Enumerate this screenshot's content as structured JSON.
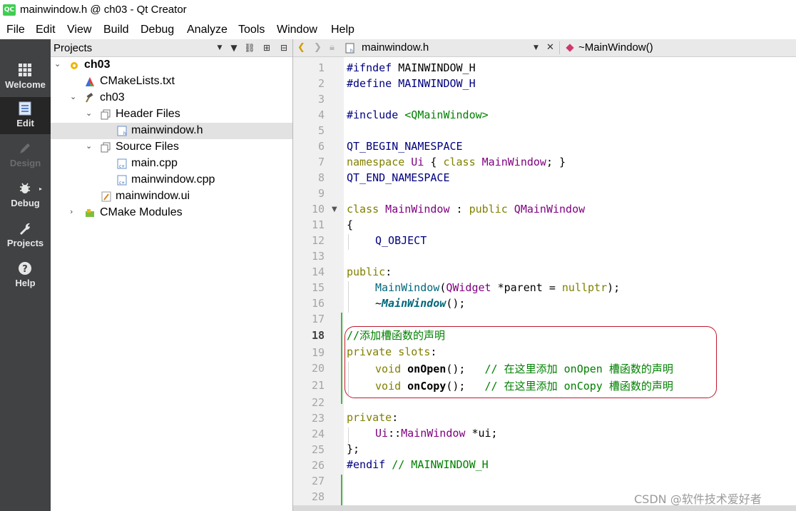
{
  "window": {
    "title": "mainwindow.h @ ch03 - Qt Creator",
    "app_icon": "QC"
  },
  "menu": [
    "File",
    "Edit",
    "View",
    "Build",
    "Debug",
    "Analyze",
    "Tools",
    "Window",
    "Help"
  ],
  "modes": [
    {
      "label": "Welcome",
      "icon": "grid-icon"
    },
    {
      "label": "Edit",
      "icon": "document-icon"
    },
    {
      "label": "Design",
      "icon": "pencil-icon"
    },
    {
      "label": "Debug",
      "icon": "bug-icon"
    },
    {
      "label": "Projects",
      "icon": "wrench-icon"
    },
    {
      "label": "Help",
      "icon": "help-icon"
    }
  ],
  "projects_panel": {
    "title": "Projects",
    "tree": [
      {
        "label": "ch03"
      },
      {
        "label": "CMakeLists.txt"
      },
      {
        "label": "ch03"
      },
      {
        "label": "Header Files"
      },
      {
        "label": "mainwindow.h"
      },
      {
        "label": "Source Files"
      },
      {
        "label": "main.cpp"
      },
      {
        "label": "mainwindow.cpp"
      },
      {
        "label": "mainwindow.ui"
      },
      {
        "label": "CMake Modules"
      }
    ]
  },
  "editor": {
    "file_name": "mainwindow.h",
    "symbol": "~MainWindow()",
    "current_line": 18,
    "lines": [
      "1",
      "2",
      "3",
      "4",
      "5",
      "6",
      "7",
      "8",
      "9",
      "10",
      "11",
      "12",
      "13",
      "14",
      "15",
      "16",
      "17",
      "18",
      "19",
      "20",
      "21",
      "22",
      "23",
      "24",
      "25",
      "26",
      "27",
      "28"
    ],
    "code": {
      "l1a": "#ifndef",
      "l1b": " MAINWINDOW_H",
      "l2a": "#define",
      "l2b": " MAINWINDOW_H",
      "l4a": "#include",
      "l4b": " <QMainWindow>",
      "l6": "QT_BEGIN_NAMESPACE",
      "l7a": "namespace",
      "l7b": " Ui",
      "l7c": " { ",
      "l7d": "class",
      "l7e": " MainWindow",
      "l7f": "; }",
      "l8": "QT_END_NAMESPACE",
      "l10a": "class",
      "l10b": " MainWindow",
      "l10c": " : ",
      "l10d": "public",
      "l10e": " QMainWindow",
      "l11": "{",
      "l12": "Q_OBJECT",
      "l14a": "public",
      ":": ":",
      "l15a": "MainWindow",
      "l15b": "(",
      "l15c": "QWidget",
      "l15d": " *parent = ",
      "l15e": "nullptr",
      "l15f": ");",
      "l16a": "~",
      "l16b": "MainWindow",
      "l16c": "();",
      "l18": "//添加槽函数的声明",
      "l19a": "private slots",
      "l19b": ":",
      "l20a": "void",
      "l20b": " onOpen",
      "l20c": "();",
      "l20d": "   // 在这里添加 onOpen 槽函数的声明",
      "l21a": "void",
      "l21b": " onCopy",
      "l21c": "();",
      "l21d": "   // 在这里添加 onCopy 槽函数的声明",
      "l23a": "private",
      "l23b": ":",
      "l24a": "Ui",
      "l24b": "::",
      "l24c": "MainWindow",
      "l24d": " *ui;",
      "l25": "};",
      "l26a": "#endif",
      "l26b": " // MAINWINDOW_H"
    }
  },
  "watermark": "CSDN @软件技术爱好者",
  "colors": {
    "mode_bar": "#404244",
    "mode_active": "#262626",
    "highlight_box": "#c0192c",
    "change_bar": "#4bb34b"
  }
}
